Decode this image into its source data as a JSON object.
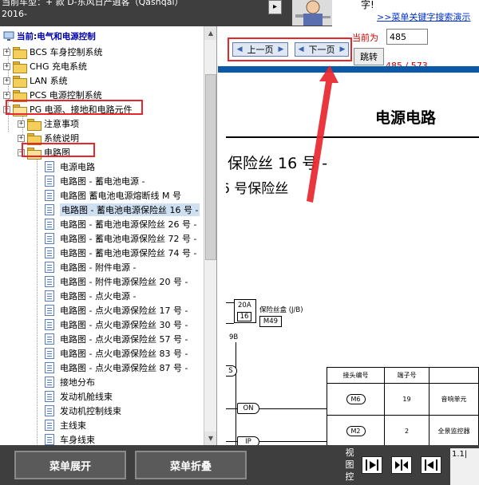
{
  "header": {
    "title_line1": "当前车型：+ 款 D-东风日产逍客（Qashqai）",
    "title_line2": "2016-",
    "toggle_glyph": "▸",
    "promo_line1": "字!",
    "promo_link": ">>菜单关键字搜索演示"
  },
  "tree": {
    "current_label": "当前:电气和电源控制",
    "items": [
      {
        "label": "BCS 车身控制系统",
        "expander": "+"
      },
      {
        "label": "CHG 充电系统",
        "expander": "+"
      },
      {
        "label": "LAN 系统",
        "expander": "+"
      },
      {
        "label": "PCS 电源控制系统",
        "expander": "+"
      },
      {
        "label": "PG 电源、接地和电路元件",
        "expander": "−"
      },
      {
        "label": "注意事项",
        "expander": "+"
      },
      {
        "label": "系统说明",
        "expander": "+"
      },
      {
        "label": "电路图",
        "expander": "−"
      },
      {
        "label": "电源电路"
      },
      {
        "label": "电路图 - 蓄电池电源 -"
      },
      {
        "label": "电路图 蓄电池电源熔断线 M 号"
      },
      {
        "label": "电路图 - 蓄电池电源保险丝 16 号 -"
      },
      {
        "label": "电路图 - 蓄电池电源保险丝 26 号 -"
      },
      {
        "label": "电路图 - 蓄电池电源保险丝 72 号 -"
      },
      {
        "label": "电路图 - 蓄电池电源保险丝 74 号 -"
      },
      {
        "label": "电路图 - 附件电源 -"
      },
      {
        "label": "电路图 - 附件电源保险丝 20 号 -"
      },
      {
        "label": "电路图 - 点火电源 -"
      },
      {
        "label": "电路图 - 点火电源保险丝 17 号 -"
      },
      {
        "label": "电路图 - 点火电源保险丝 30 号 -"
      },
      {
        "label": "电路图 - 点火电源保险丝 57 号 -"
      },
      {
        "label": "电路图 - 点火电源保险丝 83 号 -"
      },
      {
        "label": "电路图 - 点火电源保险丝 87 号 -"
      },
      {
        "label": "接地分布"
      },
      {
        "label": "发动机舱线束"
      },
      {
        "label": "发动机控制线束"
      },
      {
        "label": "主线束"
      },
      {
        "label": "车身线束"
      }
    ],
    "selected_index": 11
  },
  "nav": {
    "prev_label": "上一页",
    "next_label": "下一页",
    "current_page_label": "当前为",
    "page_value": "485",
    "go_label": "跳转",
    "page_count": "485 / 573"
  },
  "document": {
    "title": "电源电路",
    "heading1": "保险丝 16 号 -",
    "heading2": "6 号保险丝",
    "fuse_rating": "20A",
    "fuse_number": "16",
    "fuse_label": "保险丝盒 (J/B)",
    "fuse_connector": "M49",
    "wire_label_9b": "9B",
    "tag_s": "S",
    "tag_on": "ON",
    "tag_ip": "IP",
    "table_headers": [
      "接头编号",
      "端子号",
      ""
    ],
    "table_rows": [
      {
        "connector": "M6",
        "terminal": "19",
        "name": "音响单元"
      },
      {
        "connector": "M2",
        "terminal": "2",
        "name": "全景监控器"
      }
    ],
    "scroll_label": "1.1|"
  },
  "bottom": {
    "expand_label": "菜单展开",
    "collapse_label": "菜单折叠",
    "view_control_label": "视图控",
    "zoom_label": "1.1|"
  },
  "colors": {
    "toolbar_bg": "#3e3e3e",
    "highlight_red": "#e8262c",
    "nav_blue": "#0a58a8",
    "tree_header_blue": "#0000aa",
    "page_count_red": "#cc0000"
  }
}
